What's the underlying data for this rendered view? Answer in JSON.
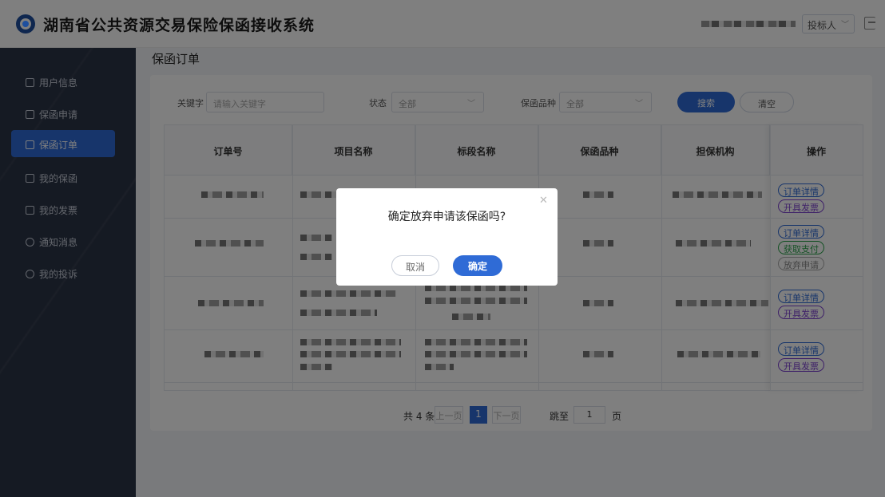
{
  "header": {
    "title": "湖南省公共资源交易保险保函接收系统",
    "role": "投标人",
    "logo_icon": "emblem-icon",
    "logout_icon": "logout-icon"
  },
  "sidebar": {
    "items": [
      {
        "label": "用户信息",
        "icon": "user-info-icon"
      },
      {
        "label": "保函申请",
        "icon": "send-icon"
      },
      {
        "label": "保函订单",
        "icon": "order-icon",
        "active": true
      },
      {
        "label": "我的保函",
        "icon": "document-icon"
      },
      {
        "label": "我的发票",
        "icon": "invoice-icon"
      },
      {
        "label": "通知消息",
        "icon": "bell-icon"
      },
      {
        "label": "我的投诉",
        "icon": "complaint-icon"
      }
    ]
  },
  "main": {
    "page_title": "保函订单",
    "filters": {
      "keyword_label": "关键字",
      "keyword_placeholder": "请输入关键字",
      "status_label": "状态",
      "status_value": "全部",
      "type_label": "保函品种",
      "type_value": "全部",
      "search_label": "搜索",
      "clear_label": "清空"
    },
    "table": {
      "columns": [
        "订单号",
        "项目名称",
        "标段名称",
        "保函品种",
        "担保机构",
        "操作"
      ],
      "rows": [
        {
          "actions": [
            "订单详情",
            "开具发票"
          ]
        },
        {
          "actions": [
            "订单详情",
            "获取支付",
            "放弃申请"
          ]
        },
        {
          "actions": [
            "订单详情",
            "开具发票"
          ]
        },
        {
          "actions": [
            "订单详情",
            "开具发票"
          ]
        }
      ]
    },
    "pagination": {
      "total": "共 4 条",
      "prev": "上一页",
      "current": "1",
      "next": "下一页",
      "jump_label": "跳至",
      "jump_value": "1",
      "page_suffix": "页"
    }
  },
  "modal": {
    "message": "确定放弃申请该保函吗?",
    "cancel_label": "取消",
    "confirm_label": "确定",
    "close_icon": "close-icon"
  },
  "colors": {
    "primary": "#2f6bd6",
    "sidebar_bg": "#2b3446",
    "tag_purple": "#7b3fd0",
    "tag_green": "#2aa34a"
  }
}
